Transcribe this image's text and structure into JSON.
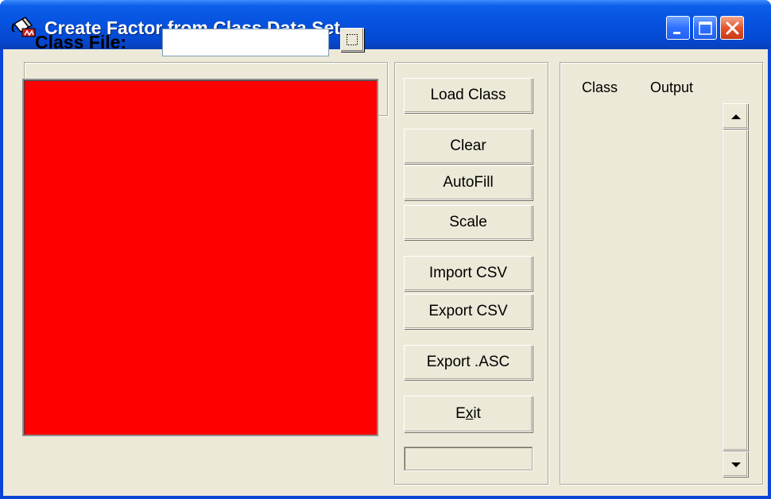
{
  "window": {
    "title": "Create Factor from Class Data Set"
  },
  "file": {
    "label": "Class File:",
    "value": "",
    "placeholder": ""
  },
  "buttons": {
    "load_class": "Load Class",
    "clear": "Clear",
    "autofill": "AutoFill",
    "scale": "Scale",
    "import_csv": "Import CSV",
    "export_csv": "Export CSV",
    "export_asc": "Export .ASC",
    "exit_prefix": "E",
    "exit_mnemonic": "x",
    "exit_suffix": "it"
  },
  "list": {
    "col_class": "Class",
    "col_output": "Output"
  },
  "colors": {
    "canvas": "#ff0000",
    "titlebar": "#0653e0",
    "client": "#ece9d8"
  },
  "icons": {
    "app": "paint-bucket-icon",
    "minimize": "minimize-icon",
    "maximize": "maximize-icon",
    "close": "close-icon",
    "browse": "browse-icon",
    "scroll_up": "arrow-up-icon",
    "scroll_down": "arrow-down-icon"
  }
}
